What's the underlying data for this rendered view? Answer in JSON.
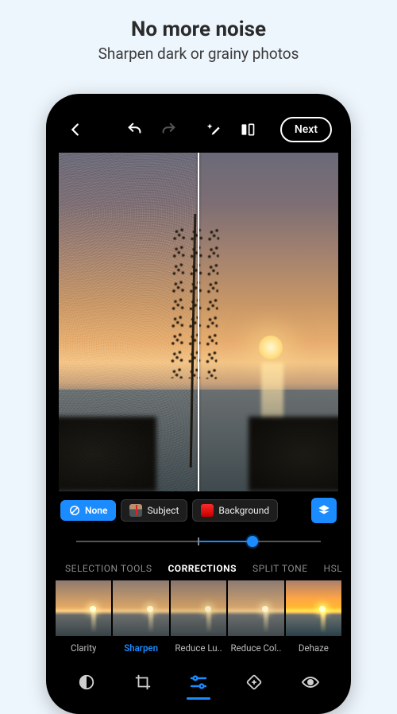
{
  "promo": {
    "title": "No more noise",
    "subtitle": "Sharpen dark or grainy photos"
  },
  "toolbar": {
    "next_label": "Next"
  },
  "masks": {
    "none": "None",
    "subject": "Subject",
    "background": "Background"
  },
  "slider": {
    "value_percent": 72
  },
  "categories": {
    "items": [
      "SELECTION TOOLS",
      "CORRECTIONS",
      "SPLIT TONE",
      "HSL"
    ],
    "active_index": 1
  },
  "corrections": {
    "items": [
      {
        "label": "Clarity"
      },
      {
        "label": "Sharpen"
      },
      {
        "label": "Reduce Lu.."
      },
      {
        "label": "Reduce Col.."
      },
      {
        "label": "Dehaze"
      }
    ],
    "active_index": 1
  },
  "colors": {
    "accent": "#1a8cff"
  }
}
